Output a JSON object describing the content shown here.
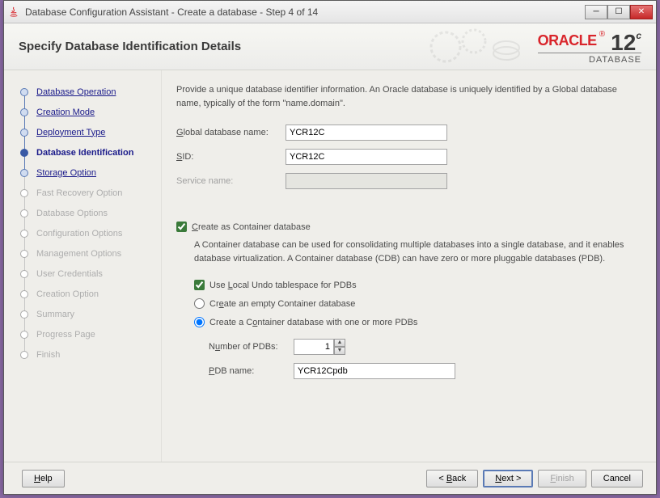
{
  "window": {
    "title": "Database Configuration Assistant - Create a database - Step 4 of 14"
  },
  "header": {
    "title": "Specify Database Identification Details",
    "brand": "ORACLE",
    "version": "12",
    "versionSuffix": "c",
    "subbrand": "DATABASE"
  },
  "sidebar": {
    "steps": [
      {
        "label": "Database Operation",
        "state": "done"
      },
      {
        "label": "Creation Mode",
        "state": "done"
      },
      {
        "label": "Deployment Type",
        "state": "done"
      },
      {
        "label": "Database Identification",
        "state": "active"
      },
      {
        "label": "Storage Option",
        "state": "nextlink"
      },
      {
        "label": "Fast Recovery Option",
        "state": "future"
      },
      {
        "label": "Database Options",
        "state": "future"
      },
      {
        "label": "Configuration Options",
        "state": "future"
      },
      {
        "label": "Management Options",
        "state": "future"
      },
      {
        "label": "User Credentials",
        "state": "future"
      },
      {
        "label": "Creation Option",
        "state": "future"
      },
      {
        "label": "Summary",
        "state": "future"
      },
      {
        "label": "Progress Page",
        "state": "future"
      },
      {
        "label": "Finish",
        "state": "future"
      }
    ]
  },
  "main": {
    "intro": "Provide a unique database identifier information. An Oracle database is uniquely identified by a Global database name, typically of the form \"name.domain\".",
    "fields": {
      "globalDbNameLabel": "Global database name:",
      "globalDbName": "YCR12C",
      "sidLabel": "SID:",
      "sid": "YCR12C",
      "serviceNameLabel": "Service name:",
      "serviceName": ""
    },
    "cdb": {
      "createLabel": "Create as Container database",
      "desc": "A Container database can be used for consolidating multiple databases into a single database, and it enables database virtualization. A Container database (CDB) can have zero or more pluggable databases (PDB).",
      "localUndoLabel": "Use Local Undo tablespace for PDBs",
      "emptyLabel": "Create an empty Container database",
      "withPdbLabel": "Create a Container database with one or more PDBs",
      "numPdbLabel": "Number of PDBs:",
      "numPdb": "1",
      "pdbNameLabel": "PDB name:",
      "pdbName": "YCR12Cpdb"
    }
  },
  "footer": {
    "help": "Help",
    "back": "< Back",
    "next": "Next >",
    "finish": "Finish",
    "cancel": "Cancel"
  }
}
